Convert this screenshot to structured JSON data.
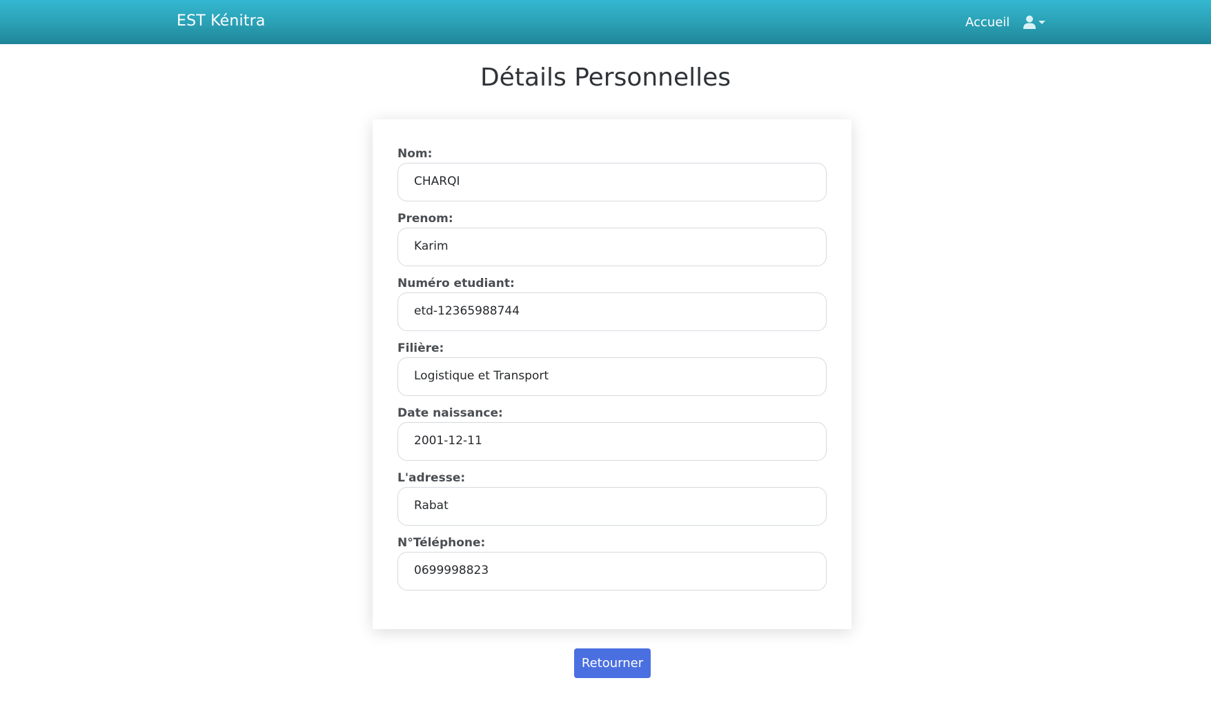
{
  "navbar": {
    "brand": "EST Kénitra",
    "home_link": "Accueil",
    "user_icon": "user-icon",
    "background": "#2a9fb3"
  },
  "page_title": "Détails Personnelles",
  "fields": [
    {
      "label": "Nom:",
      "value": "CHARQI"
    },
    {
      "label": "Prenom:",
      "value": "Karim"
    },
    {
      "label": "Numéro etudiant:",
      "value": "etd-12365988744"
    },
    {
      "label": "Filière:",
      "value": "Logistique et Transport"
    },
    {
      "label": "Date naissance:",
      "value": "2001-12-11"
    },
    {
      "label": "L'adresse:",
      "value": "Rabat"
    },
    {
      "label": "N°Téléphone:",
      "value": "0699998823"
    }
  ],
  "actions": {
    "back_label": "Retourner",
    "back_color": "#4a6fe0"
  }
}
